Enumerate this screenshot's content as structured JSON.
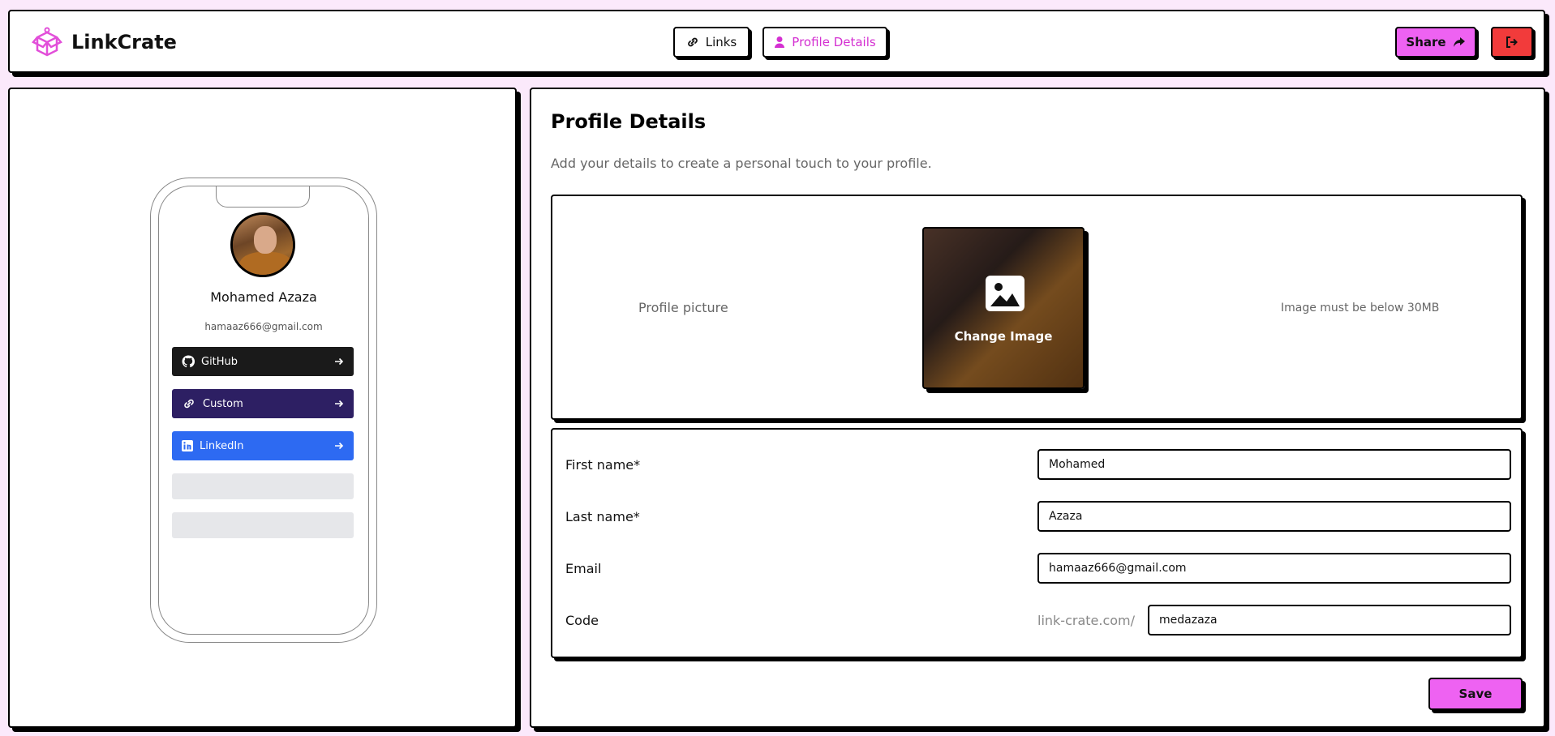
{
  "header": {
    "brand": "LinkCrate",
    "tabs": [
      {
        "label": "Links",
        "icon": "link-icon",
        "active": false
      },
      {
        "label": "Profile Details",
        "icon": "user-icon",
        "active": true
      }
    ],
    "share_label": "Share",
    "logout_icon": "logout-icon"
  },
  "preview": {
    "name": "Mohamed Azaza",
    "email": "hamaaz666@gmail.com",
    "links": [
      {
        "label": "GitHub",
        "icon": "github-icon",
        "color": "#1a1a1a"
      },
      {
        "label": "Custom",
        "icon": "link-icon",
        "color": "#2d1f63"
      },
      {
        "label": "LinkedIn",
        "icon": "linkedin-icon",
        "color": "#2d6af2"
      }
    ]
  },
  "profile": {
    "title": "Profile Details",
    "subtitle": "Add your details to create a personal touch to your profile.",
    "picture_label": "Profile picture",
    "change_image_label": "Change Image",
    "picture_note": "Image must be below 30MB",
    "fields": {
      "first_name_label": "First name*",
      "first_name": "Mohamed",
      "last_name_label": "Last name*",
      "last_name": "Azaza",
      "email_label": "Email",
      "email": "hamaaz666@gmail.com",
      "code_label": "Code",
      "code_prefix": "link-crate.com/",
      "code": "medazaza"
    },
    "save_label": "Save"
  },
  "colors": {
    "accent": "#ee62f2",
    "accent_text": "#d42fd1",
    "danger": "#f23b3b",
    "background": "#fbe9fb"
  }
}
